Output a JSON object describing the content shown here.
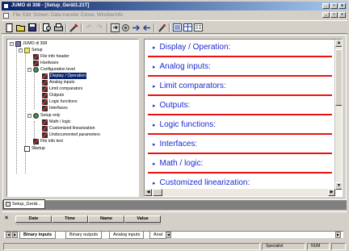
{
  "app": {
    "title": "JUMO di 308 - [Setup_Gerät1.21T]"
  },
  "menu": {
    "items": [
      "File",
      "Edit",
      "Screen",
      "Data transfer",
      "Extras",
      "Window",
      "Info"
    ]
  },
  "tree": {
    "root": "JUMO di 308",
    "setup": "Setup",
    "file_info_header": "File info header",
    "hardware": "Hardware",
    "configuration_level": "Configuration level",
    "display_operation": "Display / Operation",
    "analog_inputs": "Analog inputs",
    "limit_comparators": "Limit comparators",
    "outputs": "Outputs",
    "logic_functions": "Logic functions",
    "interfaces": "Interfaces",
    "setup_only": "Setup only",
    "math_logic": "Math / logic",
    "customized_linearization": "Customized linearization",
    "undocumented_parameters": "Undocumented parameters",
    "file_info_text": "File info text",
    "startup": "Startup"
  },
  "sections": [
    "Display / Operation:",
    "Analog inputs:",
    "Limit comparators:",
    "Outputs:",
    "Logic functions:",
    "Interfaces:",
    "Math / logic:",
    "Customized linearization:"
  ],
  "document_tab": "Setup_Gerät...",
  "grid": {
    "columns": [
      "Date",
      "Time",
      "Name",
      "Value"
    ]
  },
  "sheet_tabs": [
    "Binary inputs",
    "Binary outputs",
    "Analog inputs",
    "Anal"
  ],
  "status": {
    "user": "Specialist",
    "num": "NUM"
  },
  "colors": {
    "section_text": "#1a2ad0",
    "section_rule": "#ee1111",
    "selection": "#0a246a"
  }
}
